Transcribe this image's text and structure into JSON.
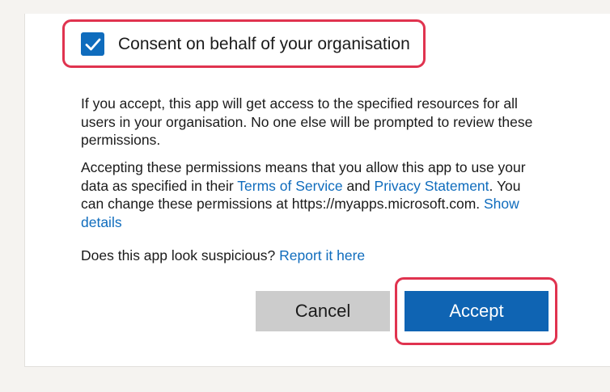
{
  "consent": {
    "checked": true,
    "label": "Consent on behalf of your organisation"
  },
  "info": {
    "paragraph1": "If you accept, this app will get access to the specified resources for all users in your organisation. No one else will be prompted to review these permissions.",
    "paragraph2_part1": "Accepting these permissions means that you allow this app to use your data as specified in their ",
    "terms_link": "Terms of Service",
    "paragraph2_and": " and ",
    "privacy_link": "Privacy Statement",
    "paragraph2_part2": ". You can change these permissions at https://myapps.microsoft.com. ",
    "show_details_link": "Show details",
    "suspicious_text": "Does this app look suspicious? ",
    "report_link": "Report it here"
  },
  "buttons": {
    "cancel": "Cancel",
    "accept": "Accept"
  },
  "colors": {
    "accent": "#0f6cbd",
    "highlight": "#e0334f",
    "cancel_bg": "#cccccc"
  },
  "icons": {
    "checkbox": "checkmark-icon"
  }
}
